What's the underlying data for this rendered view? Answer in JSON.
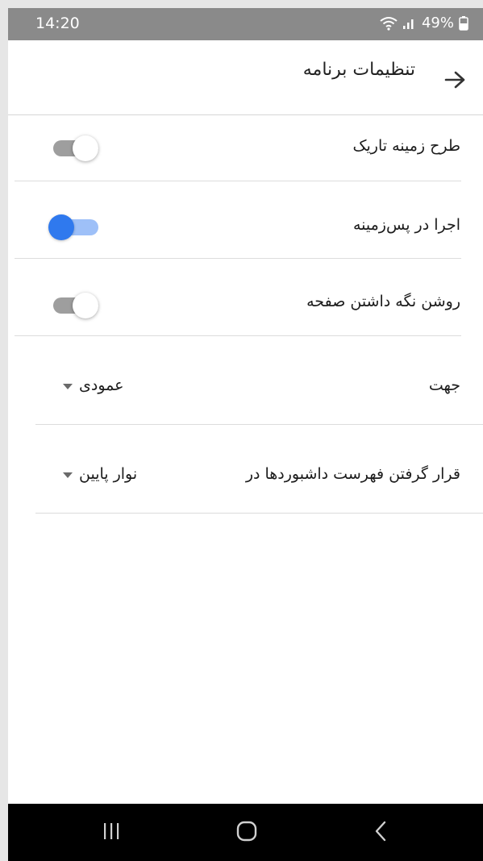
{
  "status_bar": {
    "time": "14:20",
    "battery": "49%",
    "icons": [
      "wifi-icon",
      "signal-icon",
      "battery-icon"
    ]
  },
  "app_bar": {
    "title": "تنظیمات برنامه",
    "back_icon": "arrow-right-icon"
  },
  "settings": {
    "dark_theme": {
      "label": "طرح زمینه تاریک",
      "on": false
    },
    "run_in_background": {
      "label": "اجرا در پس‌زمینه",
      "on": true
    },
    "keep_screen_on": {
      "label": "روشن نگه داشتن صفحه",
      "on": false
    },
    "orientation": {
      "label": "جهت",
      "value": "عمودی"
    },
    "dashboard_list_position": {
      "label": "قرار گرفتن فهرست داشبوردها در",
      "value": "نوار پایین"
    }
  },
  "colors": {
    "accent": "#2f79ee",
    "status_bar": "#8a8a8a",
    "nav_bar": "#000000"
  },
  "nav_bar": {
    "icons": [
      "recents-icon",
      "home-icon",
      "back-icon"
    ]
  }
}
